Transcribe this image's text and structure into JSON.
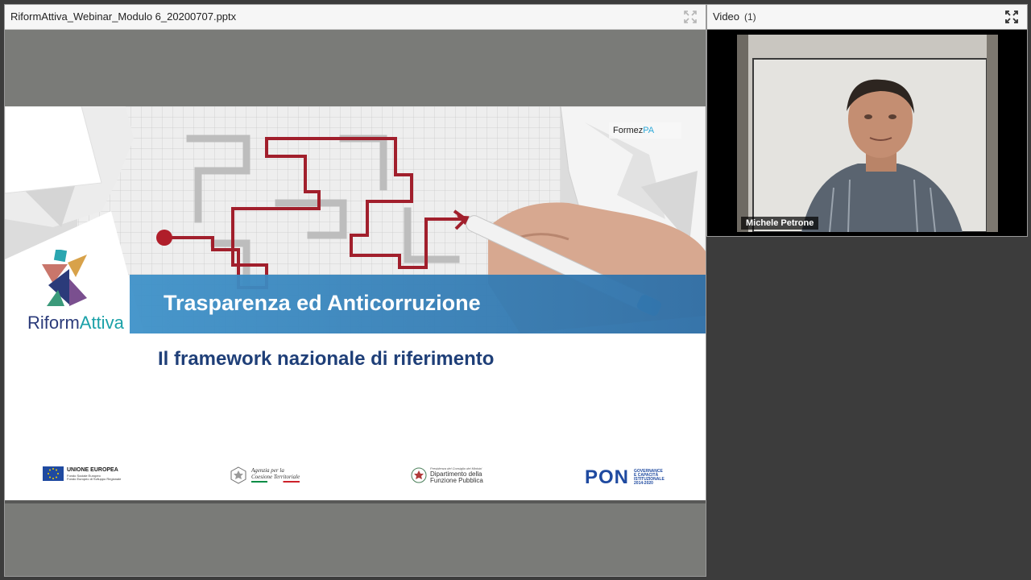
{
  "share_pod": {
    "title": "RiformAttiva_Webinar_Modulo 6_20200707.pptx",
    "fullscreen_icon": "expand-arrows-icon"
  },
  "slide": {
    "title": "Trasparenza ed Anticorruzione",
    "subtitle": "Il framework nazionale di riferimento",
    "brand_part1": "Riform",
    "brand_part2": "Attiva",
    "formez_part1": "Formez",
    "formez_part2": "PA",
    "footer": {
      "eu_title": "UNIONE EUROPEA",
      "eu_line1": "Fondo Sociale Europeo",
      "eu_line2": "Fondo Europeo di Sviluppo Regionale",
      "agency_line1": "Agenzia per la",
      "agency_line2": "Coesione Territoriale",
      "dept_top": "Presidenza del Consiglio dei Ministri",
      "dept_line1": "Dipartimento della",
      "dept_line2": "Funzione Pubblica",
      "pon_mark": "PON",
      "pon_line1": "GOVERNANCE",
      "pon_line2": "E CAPACITÀ",
      "pon_line3": "ISTITUZIONALE",
      "pon_line4": "2014-2020"
    }
  },
  "video_pod": {
    "title": "Video",
    "count": "(1)",
    "participant_name": "Michele Petrone",
    "fullscreen_icon": "expand-arrows-icon"
  },
  "colors": {
    "banner": "#3a86c0",
    "subtitle": "#1f3f78",
    "brand_dark": "#2b3b7a",
    "brand_teal": "#1aa1a8",
    "maze_line": "#a11f2c"
  }
}
